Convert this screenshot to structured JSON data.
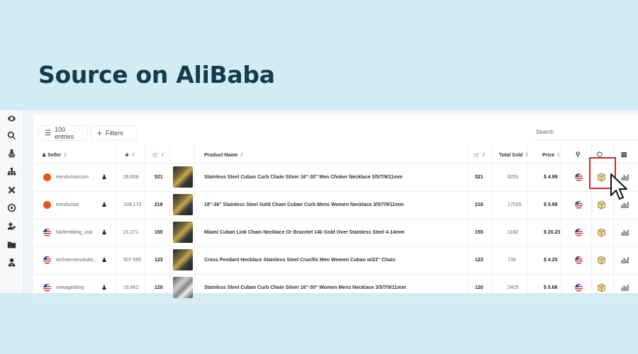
{
  "heading": "Source on AliBaba",
  "sidebar": {
    "icons": [
      "eye-icon",
      "search-icon",
      "stamp-icon",
      "sitemap-icon",
      "tools-icon",
      "target-icon",
      "user-edit-icon",
      "folder-icon",
      "user-tie-icon"
    ]
  },
  "toolbar": {
    "entries_label": "100 entries",
    "filters_label": "Filters",
    "search_placeholder": "Search"
  },
  "table": {
    "headers": {
      "seller": "Seller",
      "product_name": "Product Name",
      "total_sold": "Total Sold",
      "price": "Price"
    },
    "rows": [
      {
        "seller": "trendsmaxcom",
        "flag": "dot",
        "rating": "28.608",
        "cart": "521",
        "thumb": "gold",
        "product": "Stainless Steel Cuban Curb Chain Silver 16\"-30\" Men Choker Necklace 3/5/7/9/11mm",
        "qty": "521",
        "total_sold": "6251",
        "price": "$ 4.99"
      },
      {
        "seller": "trendsmax",
        "flag": "dot",
        "rating": "104.173",
        "cart": "218",
        "thumb": "gold",
        "product": "18\"-36\" Stainless Steel Gold Chain Cuban Curb Mens Women Necklace 3/5/7/9/11mm",
        "qty": "218",
        "total_sold": "17035",
        "price": "$ 5.99"
      },
      {
        "seller": "harlembling_usa",
        "flag": "us",
        "rating": "21.271",
        "cart": "155",
        "thumb": "gold",
        "product": "Miami Cuban Link Chain Necklace Or Bracelet 14k Gold Over Stainless Steel 4-14mm",
        "qty": "155",
        "total_sold": "1180",
        "price": "$ 20.23"
      },
      {
        "seller": "techsensesolutio...",
        "flag": "us",
        "rating": "507.695",
        "cart": "123",
        "thumb": "gold",
        "product": "Cross Pendant Necklace Stainless Steel Crucifix Men Women Cuban w/23\" Chain",
        "qty": "123",
        "total_sold": "738",
        "price": "$ 4.25"
      },
      {
        "seller": "newagebling",
        "flag": "us",
        "rating": "16.862",
        "cart": "120",
        "thumb": "silver",
        "product": "Stainless Steel Cuban Curb Chain Silver 16\"-30\" Women Mens Necklace 3/5/7/9/11mm",
        "qty": "120",
        "total_sold": "2425",
        "price": "$ 5.68"
      }
    ]
  },
  "colors": {
    "background": "#d3ebf2",
    "heading": "#143c4d",
    "highlight": "#d0282b",
    "seller_dot": "#e8541f"
  }
}
